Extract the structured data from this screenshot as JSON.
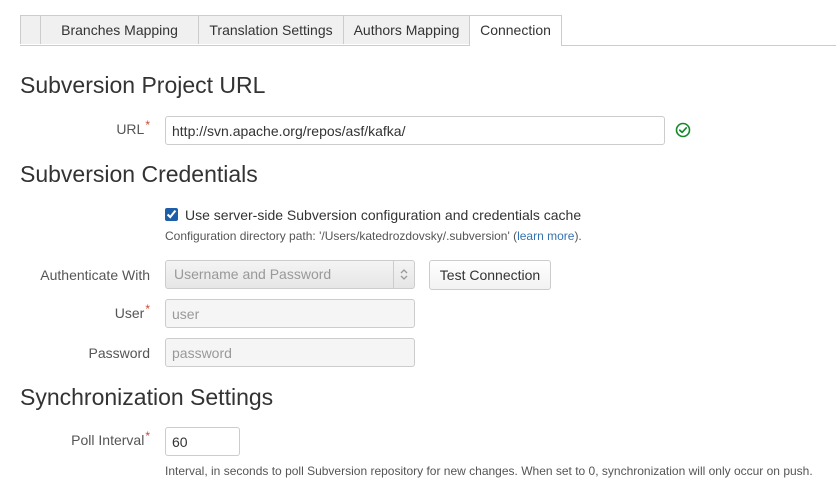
{
  "tabs": [
    {
      "label": "Branches Mapping",
      "active": false
    },
    {
      "label": "Translation Settings",
      "active": false
    },
    {
      "label": "Authors Mapping",
      "active": false
    },
    {
      "label": "Connection",
      "active": true
    }
  ],
  "project_url": {
    "heading": "Subversion Project URL",
    "label": "URL",
    "required_mark": "*",
    "value": "http://svn.apache.org/repos/asf/kafka/",
    "status_icon": "check-circle-icon",
    "status_color": "#14892c"
  },
  "credentials": {
    "heading": "Subversion Credentials",
    "use_server_side_label": "Use server-side Subversion configuration and credentials cache",
    "use_server_side_checked": true,
    "config_path_text": "Configuration directory path: '/Users/katedrozdovsky/.subversion' (",
    "learn_more": "learn more",
    "config_path_suffix": ").",
    "auth_label": "Authenticate With",
    "auth_value": "Username and Password",
    "test_button": "Test Connection",
    "user_label": "User",
    "user_placeholder": "user",
    "password_label": "Password",
    "password_placeholder": "password"
  },
  "sync": {
    "heading": "Synchronization Settings",
    "poll_label": "Poll Interval",
    "poll_value": "60",
    "poll_help": "Interval, in seconds to poll Subversion repository for new changes. When set to 0, synchronization will only occur on push."
  },
  "colors": {
    "required": "#d04437",
    "link": "#3572b0",
    "checkbox": "#1e5ea8"
  }
}
